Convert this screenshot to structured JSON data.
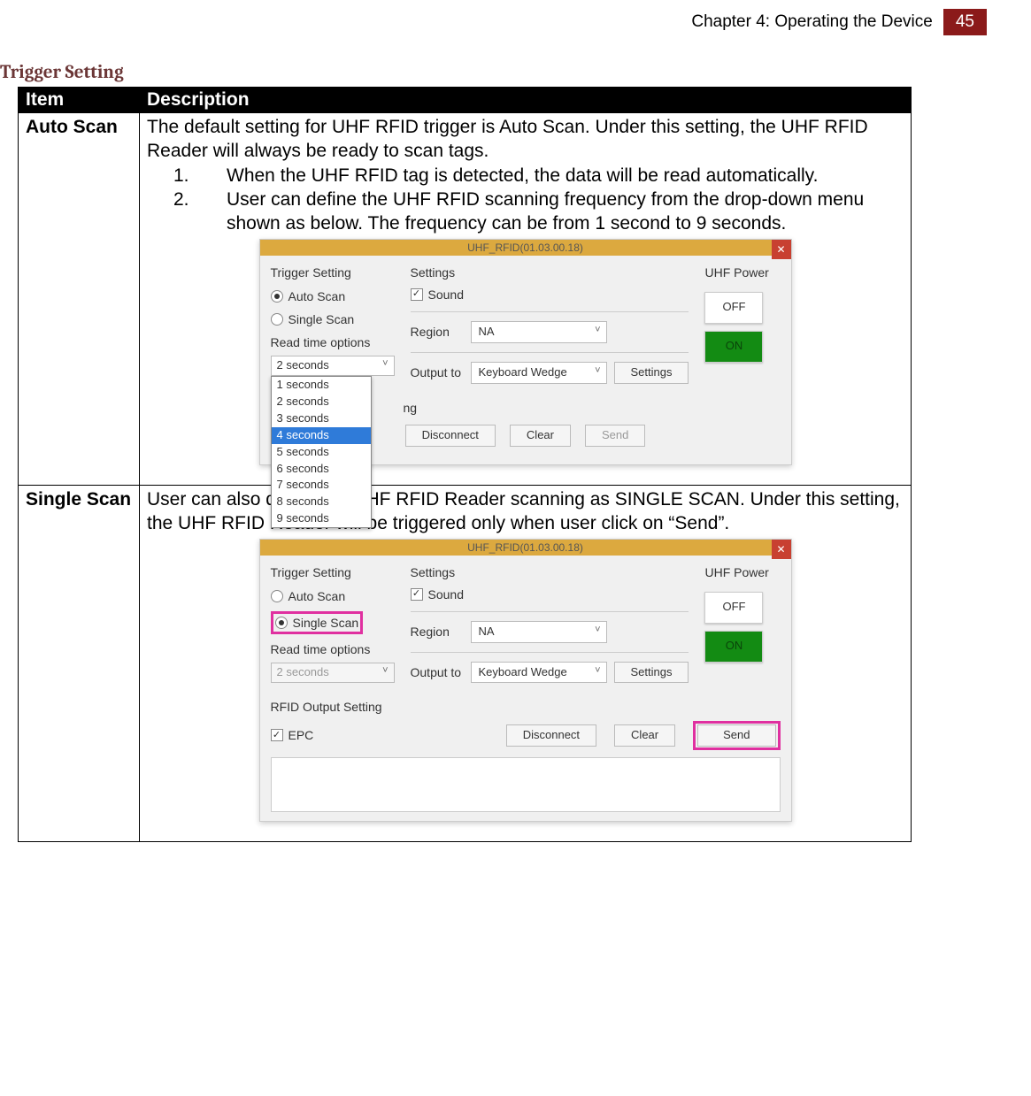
{
  "header": {
    "chapter": "Chapter 4: Operating the Device",
    "page": "45"
  },
  "section_title": "Trigger Setting",
  "table": {
    "headers": {
      "item": "Item",
      "desc": "Description"
    },
    "rows": [
      {
        "item": "Auto Scan",
        "intro": "The default setting for UHF RFID trigger is Auto Scan. Under this setting, the UHF RFID Reader will always be ready to scan tags.",
        "list": [
          "When the UHF RFID tag is detected, the data will be read automatically.",
          "User can define the UHF RFID scanning frequency from the drop-down menu"
        ],
        "list_cont": "shown as below. The frequency can be from 1 second to 9 seconds."
      },
      {
        "item": "Single Scan",
        "intro": "User can also define the UHF RFID Reader scanning as SINGLE SCAN. Under this setting, the UHF RFID Reader will be triggered only when user click on “Send”."
      }
    ]
  },
  "app": {
    "title": "UHF_RFID(01.03.00.18)",
    "trigger_setting_label": "Trigger Setting",
    "auto_scan": "Auto Scan",
    "single_scan": "Single Scan",
    "read_time_label": "Read time options",
    "read_time_value": "2 seconds",
    "dropdown_options": [
      "1 seconds",
      "2 seconds",
      "3 seconds",
      "4 seconds",
      "5 seconds",
      "6 seconds",
      "7 seconds",
      "8 seconds",
      "9 seconds"
    ],
    "dropdown_selected_index": 3,
    "settings_label": "Settings",
    "sound": "Sound",
    "region_label": "Region",
    "region_value": "NA",
    "output_to_label": "Output to",
    "output_to_value": "Keyboard Wedge",
    "settings_btn": "Settings",
    "uhf_power_label": "UHF Power",
    "off": "OFF",
    "on": "ON",
    "rfid_output_setting": "RFID Output Setting",
    "epc": "EPC",
    "ng_tail": "ng",
    "disconnect": "Disconnect",
    "clear": "Clear",
    "send": "Send"
  }
}
